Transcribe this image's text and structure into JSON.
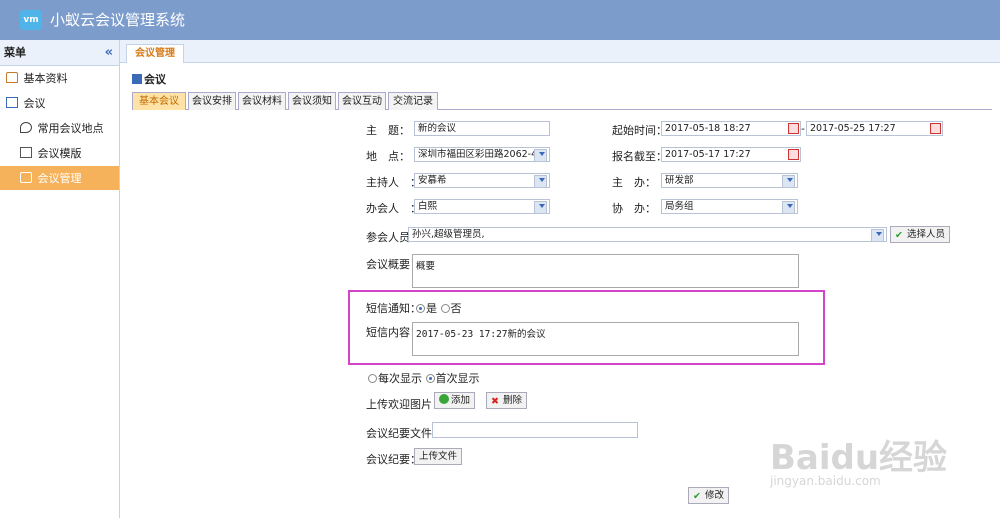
{
  "app": {
    "logo_text": "vm",
    "title": "小蚁云会议管理系统"
  },
  "sidebar": {
    "header": "菜单",
    "collapse_glyph": "«",
    "items": [
      {
        "label": "基本资料"
      },
      {
        "label": "会议"
      },
      {
        "label": "常用会议地点"
      },
      {
        "label": "会议模版"
      },
      {
        "label": "会议管理"
      }
    ]
  },
  "main": {
    "top_tab": "会议管理",
    "section_title": "会议",
    "subtabs": [
      "基本会议",
      "会议安排",
      "会议材料",
      "会议须知",
      "会议互动",
      "交流记录"
    ]
  },
  "form": {
    "subject_label": "主　题：",
    "subject_value": "新的会议",
    "start_label": "起始时间：",
    "start_value": "2017-05-18 18:27",
    "range_sep": "-",
    "end_value": "2017-05-25 17:27",
    "place_label": "地　点：",
    "place_value": "深圳市福田区彩田路2062-4",
    "deadline_label": "报名截至：",
    "deadline_value": "2017-05-17 17:27",
    "host_label": "主持人　：",
    "host_value": "安慕希",
    "organizer_label": "主　办：",
    "organizer_value": "研发部",
    "office_label": "办会人　：",
    "office_value": "白熙",
    "coorganizer_label": "协　办：",
    "coorganizer_value": "局务组",
    "attendees_label": "参会人员：",
    "attendees_value": "孙兴,超级管理员,",
    "select_people_button": "选择人员",
    "summary_label": "会议概要：",
    "summary_value": "概要",
    "sms_notice_label": "短信通知：",
    "sms_yes": "是",
    "sms_no": "否",
    "sms_content_label": "短信内容：",
    "sms_content_value": "2017-05-23 17:27新的会议",
    "display_every": "每次显示",
    "display_first": "首次显示",
    "upload_welcome_label": "上传欢迎图片：",
    "add_button": "添加",
    "delete_button": "删除",
    "minutes_file_label": "会议纪要文件：",
    "minutes_file_value": "",
    "minutes_label": "会议纪要：",
    "upload_file_button": "上传文件",
    "modify_button": "修改"
  },
  "watermark": {
    "brand": "Baidu经验",
    "url": "jingyan.baidu.com"
  },
  "colors": {
    "topbar": "#7c9ccc",
    "active_menu": "#f6b25a",
    "highlight_box": "#d444c8"
  }
}
